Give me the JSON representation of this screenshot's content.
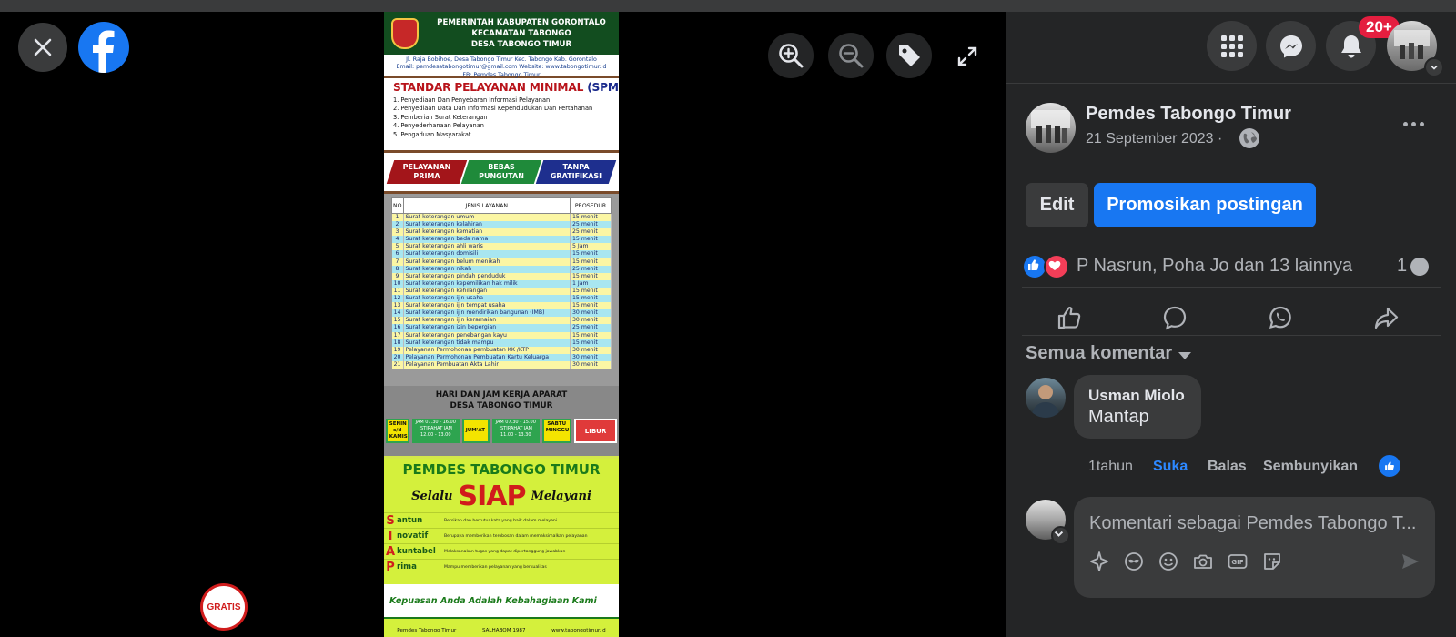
{
  "viewer": {
    "poster": {
      "header_lines": [
        "PEMERINTAH KABUPATEN GORONTALO",
        "KECAMATAN TABONGO",
        "DESA TABONGO TIMUR"
      ],
      "address_lines": [
        "Jl. Raja Bobihoe, Desa Tabongo Timur Kec. Tabongo Kab. Gorontalo",
        "Email: pemdesatabongotimur@gmail.com Website: www.tabongotimur.id",
        "FB: Pemdes Tabongo Timur"
      ],
      "spm_title_red": "STANDAR PELAYANAN MINIMAL ",
      "spm_title_blue": "(SPM)",
      "spm_items": [
        "1. Penyediaan Dan Penyebaran Informasi Pelayanan",
        "2. Penyediaan Data Dan Informasi Kependudukan Dan Pertahanan",
        "3. Pemberian Surat Keterangan",
        "4. Penyederhanaan Pelayanan",
        "5. Pengaduan Masyarakat."
      ],
      "badges": [
        {
          "text": "PELAYANAN PRIMA",
          "color": "#a3151a"
        },
        {
          "text": "BEBAS PUNGUTAN",
          "color": "#1f8a3a"
        },
        {
          "text": "TANPA GRATIFIKASI",
          "color": "#1e2f8e"
        }
      ],
      "table_headers": {
        "no": "NO",
        "service": "JENIS LAYANAN",
        "procedure": "PROSEDUR"
      },
      "table_rows": [
        {
          "no": "1",
          "service": "Surat keterangan umum",
          "time": "15 menit"
        },
        {
          "no": "2",
          "service": "Surat keterangan kelahiran",
          "time": "25 menit"
        },
        {
          "no": "3",
          "service": "Surat keterangan kematian",
          "time": "25 menit"
        },
        {
          "no": "4",
          "service": "Surat keterangan beda nama",
          "time": "15 menit"
        },
        {
          "no": "5",
          "service": "Surat keterangan ahli waris",
          "time": "5 Jam"
        },
        {
          "no": "6",
          "service": "Surat keterangan domisili",
          "time": "15 menit"
        },
        {
          "no": "7",
          "service": "Surat keterangan belum menikah",
          "time": "15 menit"
        },
        {
          "no": "8",
          "service": "Surat keterangan nikah",
          "time": "25 menit"
        },
        {
          "no": "9",
          "service": "Surat keterangan pindah penduduk",
          "time": "15 menit"
        },
        {
          "no": "10",
          "service": "Surat keterangan kepemilikan hak milik",
          "time": "1 Jam"
        },
        {
          "no": "11",
          "service": "Surat keterangan kehilangan",
          "time": "15 menit"
        },
        {
          "no": "12",
          "service": "Surat keterangan ijin usaha",
          "time": "15 menit"
        },
        {
          "no": "13",
          "service": "Surat keterangan ijin tempat usaha",
          "time": "15 menit"
        },
        {
          "no": "14",
          "service": "Surat keterangan ijin mendirikan bangunan (IMB)",
          "time": "30 menit"
        },
        {
          "no": "15",
          "service": "Surat keterangan ijin keramaian",
          "time": "30 menit"
        },
        {
          "no": "16",
          "service": "Surat keterangan izin bepergian",
          "time": "25 menit"
        },
        {
          "no": "17",
          "service": "Surat keterangan penebangan kayu",
          "time": "15 menit"
        },
        {
          "no": "18",
          "service": "Surat keterangan tidak mampu",
          "time": "15 menit"
        },
        {
          "no": "19",
          "service": "Pelayanan Permohonan pembuatan KK /KTP",
          "time": "30 menit"
        },
        {
          "no": "20",
          "service": "Pelayanan Permohonan Pembuatan Kartu Keluarga",
          "time": "30 menit"
        },
        {
          "no": "21",
          "service": "Pelayanan Pembuatan Akta Lahir",
          "time": "30 menit"
        }
      ],
      "hours_title_lines": [
        "HARI DAN JAM KERJA APARAT",
        "DESA TABONGO TIMUR"
      ],
      "hours_days_1": "SENIN s/d KAMIS",
      "hours_time_1": "JAM 07.30 - 16.00 ISTIRAHAT JAM 12.00 - 13.00",
      "hours_days_2": "JUM'AT",
      "hours_time_2": "JAM 07.30 - 15.00 ISTIRAHAT JAM 11.00 - 13.30",
      "hours_days_3": "SABTU MINGGU",
      "hours_off": "LIBUR",
      "siap_title": "PEMDES TABONGO TIMUR",
      "siap_left": "Selalu",
      "siap_big": "SIAP",
      "siap_right": "Melayani",
      "siap_rows": [
        {
          "letter": "S",
          "word": "antun",
          "desc": "Bersikap dan bertutur kata yang baik dalam melayani"
        },
        {
          "letter": "I",
          "word": "novatif",
          "desc": "Berupaya memberikan terobosan dalam memaksimalkan pelayanan"
        },
        {
          "letter": "A",
          "word": "kuntabel",
          "desc": "Melaksanakan tugas yang dapat dipertanggung jawabkan"
        },
        {
          "letter": "P",
          "word": "rima",
          "desc": "Mampu memberikan pelayanan yang berkualitas"
        }
      ],
      "gratis": "GRATIS",
      "kepuasan": "Kepuasan Anda Adalah Kebahagiaan Kami",
      "footer_items": [
        "Pemdes Tabongo Timur",
        "SALHABOM 1987",
        "www.tabongotimur.id"
      ]
    }
  },
  "topbar": {
    "notification_count": "20+"
  },
  "post": {
    "page_name": "Pemdes Tabongo Timur",
    "date": "21 September 2023 ·",
    "edit_label": "Edit",
    "promote_label": "Promosikan postingan",
    "reaction_summary": "P Nasrun, Poha Jo dan 13 lainnya",
    "comment_count": "1",
    "comment_filter": "Semua komentar"
  },
  "comment": {
    "author": "Usman Miolo",
    "text": "Mantap",
    "time": "1tahun",
    "like_label": "Suka",
    "reply_label": "Balas",
    "hide_label": "Sembunyikan"
  },
  "composer": {
    "placeholder": "Komentari sebagai Pemdes Tabongo T..."
  },
  "colors": {
    "accent": "#1877f2",
    "panel": "#242526",
    "surface": "#3a3b3c",
    "notification": "#e41e3f"
  }
}
